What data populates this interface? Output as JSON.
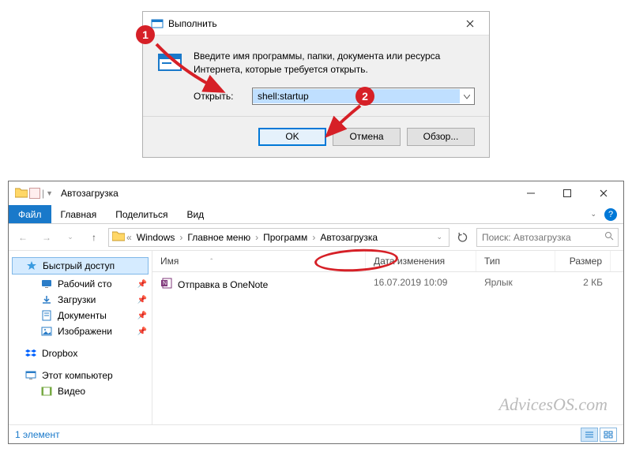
{
  "run": {
    "title": "Выполнить",
    "hint_line1": "Введите имя программы, папки, документа или ресурса",
    "hint_line2": "Интернета, которые требуется открыть.",
    "open_label": "Открыть:",
    "value": "shell:startup",
    "ok": "OK",
    "cancel": "Отмена",
    "browse": "Обзор..."
  },
  "anno": {
    "s1": "1",
    "s2": "2"
  },
  "explorer": {
    "title": "Автозагрузка",
    "tabs": {
      "file": "Файл",
      "home": "Главная",
      "share": "Поделиться",
      "view": "Вид"
    },
    "breadcrumb": [
      "Windows",
      "Главное меню",
      "Программ",
      "Автозагрузка"
    ],
    "search_placeholder": "Поиск: Автозагрузка",
    "columns": {
      "name": "Имя",
      "date": "Дата изменения",
      "type": "Тип",
      "size": "Размер"
    },
    "nav": {
      "quick": "Быстрый доступ",
      "desktop": "Рабочий сто",
      "downloads": "Загрузки",
      "documents": "Документы",
      "pictures": "Изображени",
      "dropbox": "Dropbox",
      "thispc": "Этот компьютер",
      "videos": "Видео"
    },
    "rows": [
      {
        "name": "Отправка в OneNote",
        "date": "16.07.2019 10:09",
        "type": "Ярлык",
        "size": "2 КБ"
      }
    ],
    "status": "1 элемент",
    "watermark": "AdvicesOS.com"
  }
}
